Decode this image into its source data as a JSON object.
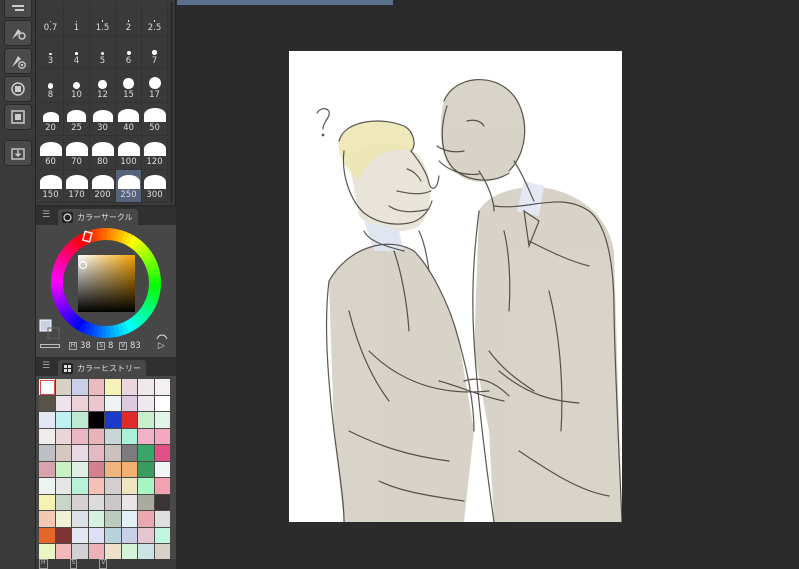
{
  "window": {
    "canvas_title": ""
  },
  "brush_sizes": [
    {
      "label": "0.7",
      "dot": 1
    },
    {
      "label": "1",
      "dot": 1
    },
    {
      "label": "1.5",
      "dot": 1.4
    },
    {
      "label": "2",
      "dot": 1.6
    },
    {
      "label": "2.5",
      "dot": 1.8
    },
    {
      "label": "3",
      "dot": 2.2
    },
    {
      "label": "4",
      "dot": 2.6
    },
    {
      "label": "5",
      "dot": 3.4
    },
    {
      "label": "6",
      "dot": 4
    },
    {
      "label": "7",
      "dot": 4.6
    },
    {
      "label": "8",
      "dot": 5.4
    },
    {
      "label": "10",
      "dot": 7
    },
    {
      "label": "12",
      "dot": 8.5
    },
    {
      "label": "15",
      "dot": 10.5
    },
    {
      "label": "17",
      "dot": 12
    },
    {
      "label": "20",
      "dot": 16
    },
    {
      "label": "25",
      "dot": 19
    },
    {
      "label": "30",
      "dot": 20
    },
    {
      "label": "40",
      "dot": 21
    },
    {
      "label": "50",
      "dot": 22
    },
    {
      "label": "60",
      "dot": 22
    },
    {
      "label": "70",
      "dot": 22
    },
    {
      "label": "80",
      "dot": 22
    },
    {
      "label": "100",
      "dot": 22
    },
    {
      "label": "120",
      "dot": 22
    },
    {
      "label": "150",
      "dot": 22
    },
    {
      "label": "170",
      "dot": 22
    },
    {
      "label": "200",
      "dot": 22
    },
    {
      "label": "250",
      "dot": 22,
      "selected": true
    },
    {
      "label": "300",
      "dot": 22
    }
  ],
  "color_circle": {
    "tab_label": "カラーサークル",
    "h_key": "H",
    "h_value": "38",
    "s_key": "S",
    "s_value": "8",
    "v_key": "V",
    "v_value": "83",
    "main_color": "#c9d3df",
    "sub_color": "#474747"
  },
  "color_history": {
    "tab_label": "カラーヒストリー",
    "swatches": [
      "#ffffff",
      "#d8d0c4",
      "#c8cfe6",
      "#ecb9bf",
      "#f7f3b6",
      "#ead6dc",
      "#eee8ea",
      "#f3eff3",
      "#59544a",
      "#eee3ea",
      "#ead2d7",
      "#ebc6ce",
      "#eff3f3",
      "#dfc9e0",
      "#ede9ef",
      "#ffffff",
      "#e3e7f3",
      "#bff1f3",
      "#bfebd2",
      "#000000",
      "#1b3ac9",
      "#e02b2b",
      "#c8f0cf",
      "#e3f5e9",
      "#f1ecec",
      "#e8d6d6",
      "#e9b7c3",
      "#e8b2ba",
      "#c8d7d6",
      "#aaf1d8",
      "#f2b1c8",
      "#f5a6c0",
      "#bcbfc3",
      "#d6c7c1",
      "#e7d8e3",
      "#e5b9c4",
      "#cbc2be",
      "#7c7c7c",
      "#3ba56a",
      "#e24f86",
      "#d8a3ad",
      "#c8f1c4",
      "#e1eee4",
      "#d67f8e",
      "#f0b57e",
      "#f1b271",
      "#399b60",
      "#eef5f3",
      "#edf3f2",
      "#e6e6e6",
      "#b9f2d8",
      "#f4c0b8",
      "#d4cfce",
      "#f0e5c0",
      "#a8f5c4",
      "#f3a1b2",
      "#f5f3b3",
      "#c8d5c9",
      "#d5d1d3",
      "#dbdbdb",
      "#cac6c9",
      "#ebe4e4",
      "#a9aba1",
      "#3b3435",
      "#f1c9b5",
      "#eff0d4",
      "#dde1e5",
      "#d4f2e0",
      "#bacbbe",
      "#e0f0f4",
      "#eaa8b1",
      "#e1dede",
      "#e5652a",
      "#7d3433",
      "#e3e7f2",
      "#e0def5",
      "#b9d3dd",
      "#c8cfe6",
      "#e4c5d0",
      "#c1f6e0",
      "#e9f6c4",
      "#f1b9ba",
      "#d0d0d5",
      "#ebb0b8",
      "#efe0ce",
      "#d3f3d9",
      "#cce3e3",
      "#d7d0c8",
      "#f7f4c1",
      "#d5e4d9",
      "#cde0e5",
      "#f3f1eb",
      "#e6b9bd",
      "#d7d1d3",
      "#c7c8c9",
      "#d1e1f4"
    ],
    "footer_h": "H",
    "footer_s": "S",
    "footer_v": "V"
  },
  "tools": [
    {
      "name": "layer-tool-icon"
    },
    {
      "name": "sub-tool-settings-icon"
    },
    {
      "name": "brush-settings-icon"
    },
    {
      "name": "navigator-icon"
    },
    {
      "name": "timeline-icon"
    },
    {
      "name": "export-icon"
    }
  ],
  "colors": {
    "ui_bg": "#2b2b2b",
    "panel_bg": "#474747",
    "selected_cell": "#56637a",
    "canvas_paper": "#ffffff",
    "sketch_line": "#3f3a33",
    "fill_beige": "#d2ccc0",
    "fill_blonde": "#ece6b2"
  }
}
